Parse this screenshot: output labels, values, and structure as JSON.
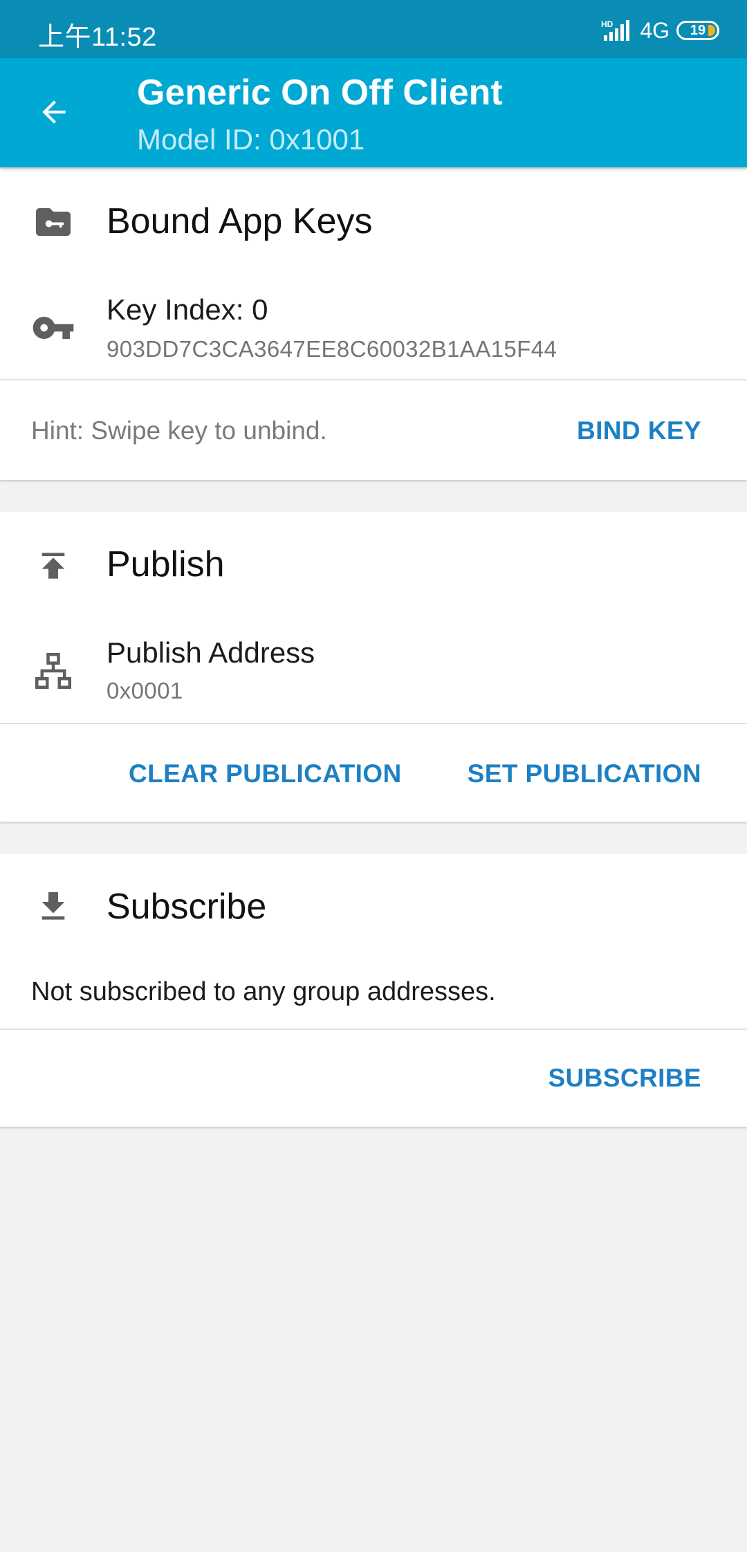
{
  "status_bar": {
    "time": "上午11:52",
    "network": "4G",
    "battery": "19",
    "icons": [
      "hd-signal-icon",
      "battery-icon"
    ]
  },
  "app_bar": {
    "title": "Generic On Off Client",
    "subtitle": "Model ID: 0x1001",
    "back_icon": "arrow-back-icon"
  },
  "bound_app_keys": {
    "title": "Bound App Keys",
    "header_icon": "folder-key-icon",
    "key_icon": "vpn-key-icon",
    "key_index_label": "Key Index: 0",
    "key_value": "903DD7C3CA3647EE8C60032B1AA15F44",
    "hint": "Hint: Swipe key to unbind.",
    "bind_key_label": "BIND KEY"
  },
  "publish": {
    "title": "Publish",
    "header_icon": "publish-icon",
    "address_icon": "network-tree-icon",
    "address_label": "Publish Address",
    "address_value": "0x0001",
    "clear_label": "CLEAR PUBLICATION",
    "set_label": "SET PUBLICATION"
  },
  "subscribe": {
    "title": "Subscribe",
    "header_icon": "download-icon",
    "empty_text": "Not subscribed to any group addresses.",
    "subscribe_label": "SUBSCRIBE"
  },
  "colors": {
    "status_bar": "#0a8db4",
    "app_bar": "#00a8d4",
    "accent": "#1e80c4",
    "background": "#f2f2f2"
  }
}
